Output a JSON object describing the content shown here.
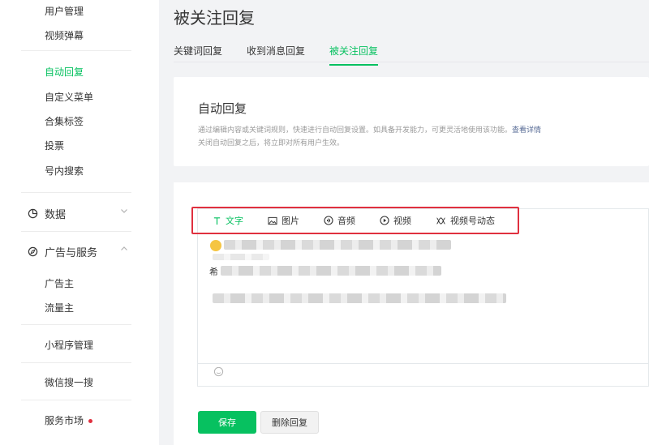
{
  "sidebar": {
    "items_top": [
      {
        "label": "用户管理",
        "active": false
      },
      {
        "label": "视频弹幕",
        "active": false
      },
      {
        "label": "自动回复",
        "active": true
      },
      {
        "label": "自定义菜单",
        "active": false
      },
      {
        "label": "合集标签",
        "active": false
      },
      {
        "label": "投票",
        "active": false
      },
      {
        "label": "号内搜索",
        "active": false
      }
    ],
    "group_data": {
      "label": "数据",
      "icon": "pie-chart-icon",
      "expanded": false
    },
    "group_ads": {
      "label": "广告与服务",
      "icon": "compass-icon",
      "expanded": true
    },
    "ads_items": [
      {
        "label": "广告主"
      },
      {
        "label": "流量主"
      }
    ],
    "miniprogram": {
      "label": "小程序管理"
    },
    "wechat_search": {
      "label": "微信搜一搜"
    },
    "service_market": {
      "label": "服务市场",
      "has_dot": true
    }
  },
  "page": {
    "title": "被关注回复",
    "tabs": [
      {
        "label": "关键词回复",
        "active": false
      },
      {
        "label": "收到消息回复",
        "active": false
      },
      {
        "label": "被关注回复",
        "active": true
      }
    ]
  },
  "auto_reply": {
    "heading": "自动回复",
    "desc1": "通过编辑内容或关键词规则，快速进行自动回复设置。如具备开发能力，可更灵活地使用该功能。",
    "desc1_link": "查看详情",
    "desc2": "关闭自动回复之后，将立即对所有用户生效。"
  },
  "editor": {
    "toolbar": [
      {
        "label": "文字",
        "icon": "text-icon",
        "active": true
      },
      {
        "label": "图片",
        "icon": "image-icon",
        "active": false
      },
      {
        "label": "音频",
        "icon": "audio-icon",
        "active": false
      },
      {
        "label": "视频",
        "icon": "video-icon",
        "active": false
      },
      {
        "label": "视频号动态",
        "icon": "channels-icon",
        "active": false
      }
    ],
    "line2_prefix": "希"
  },
  "actions": {
    "save": "保存",
    "delete": "删除回复"
  },
  "colors": {
    "accent": "#07c160",
    "highlight_box": "#e0303f",
    "link": "#576b95"
  }
}
